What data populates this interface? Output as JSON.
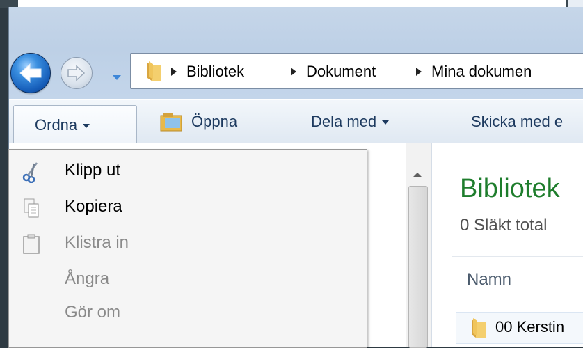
{
  "navigation": {
    "breadcrumbs": [
      "Bibliotek",
      "Dokument",
      "Mina dokumen"
    ]
  },
  "toolbar": {
    "ordna_label": "Ordna",
    "open_label": "Öppna",
    "share_label": "Dela med",
    "send_label": "Skicka med e"
  },
  "context_menu": {
    "items": [
      {
        "label": "Klipp ut",
        "icon": "scissors-icon",
        "enabled": true
      },
      {
        "label": "Kopiera",
        "icon": "copy-icon",
        "enabled": true
      },
      {
        "label": "Klistra in",
        "icon": "paste-icon",
        "enabled": false
      },
      {
        "label": "Ångra",
        "icon": "",
        "enabled": false
      },
      {
        "label": "Gör om",
        "icon": "",
        "enabled": false
      }
    ]
  },
  "library": {
    "title": "Bibliotek",
    "subtitle": "0 Släkt total",
    "column_name": "Namn",
    "first_item": "00 Kerstin"
  },
  "colors": {
    "title_green": "#1e7d2c",
    "toolbar_text": "#1d3a5f",
    "window_blue": "#c3d5ea"
  }
}
